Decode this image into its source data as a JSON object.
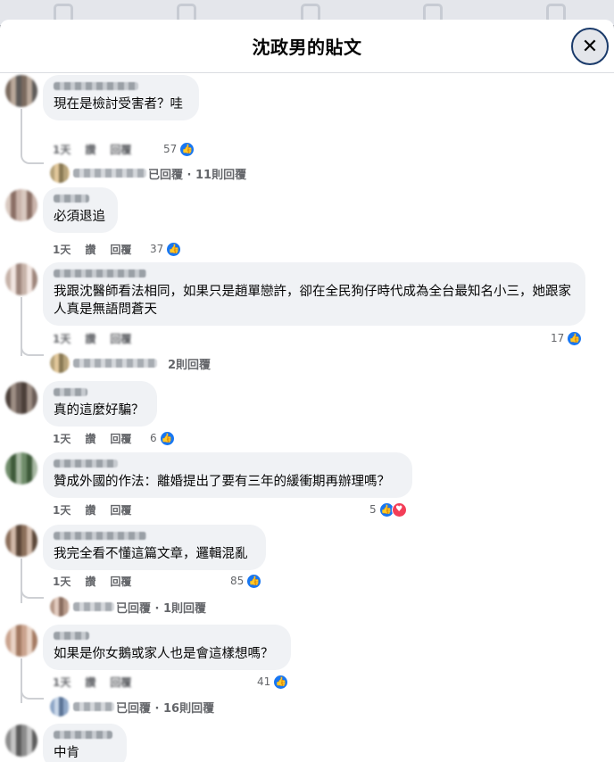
{
  "modal": {
    "title": "沈政男的貼文",
    "close_label": "✕"
  },
  "actions_labels": {
    "time": "1天",
    "like": "讚",
    "reply": "回覆"
  },
  "comments": [
    {
      "text": "現在是檢討受害者？哇",
      "likes": "57",
      "reply_summary": "已回覆 · 11則回覆"
    },
    {
      "text": "必須退追",
      "likes": "37"
    },
    {
      "text": "我跟沈醫師看法相同，如果只是趙單戀許，卻在全民狗仔時代成為全台最知名小三，她跟家人真是無語問蒼天",
      "likes": "17",
      "reply_summary": "2則回覆"
    },
    {
      "text": "真的這麼好騙？",
      "likes": "6"
    },
    {
      "text": "贊成外國的作法：離婚提出了要有三年的緩衝期再辦理嗎？",
      "likes": "5"
    },
    {
      "text": "我完全看不懂這篇文章，邏輯混亂",
      "likes": "85",
      "reply_summary": "已回覆 · 1則回覆"
    },
    {
      "text": "如果是你女鵝或家人也是會這樣想嗎？",
      "likes": "41",
      "reply_summary": "已回覆 · 16則回覆"
    },
    {
      "text": "中肯"
    }
  ],
  "icons": {
    "like": "thumbs-up-icon",
    "love": "heart-icon",
    "close": "close-icon"
  },
  "colors": {
    "like_blue": "#1877f2",
    "love_red": "#f33e58",
    "bubble_bg": "#f0f2f5",
    "meta_gray": "#65676b"
  }
}
